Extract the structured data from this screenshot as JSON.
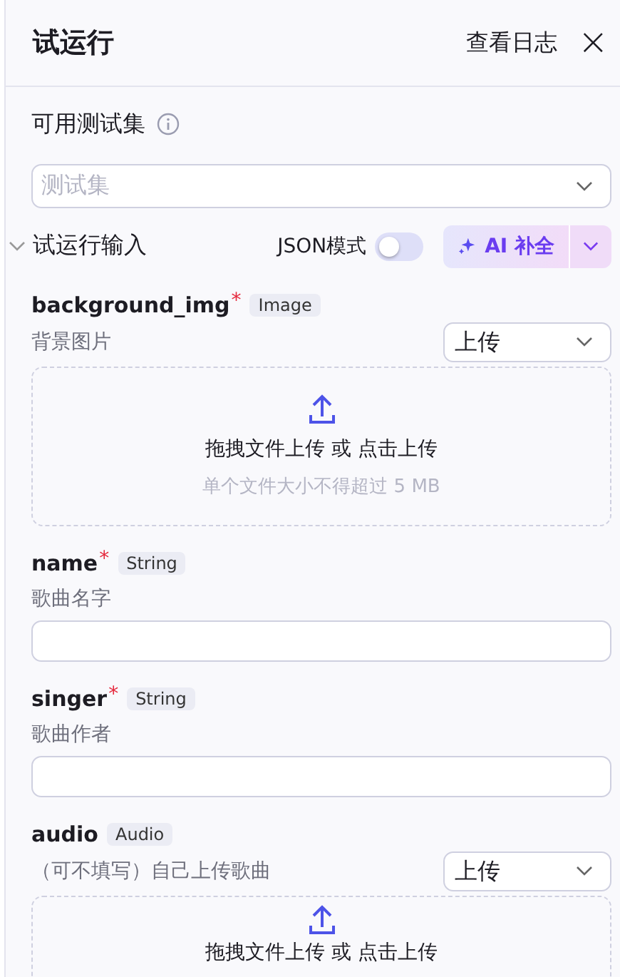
{
  "header": {
    "title": "试运行",
    "log_link": "查看日志",
    "close": "×"
  },
  "test_set": {
    "label": "可用测试集",
    "select": {
      "placeholder": "测试集"
    }
  },
  "inputs_section": {
    "title": "试运行输入",
    "expanded": true,
    "json_mode": {
      "label": "JSON模式",
      "on": false
    },
    "ai_button": "AI 补全"
  },
  "fields": [
    {
      "kind": "upload",
      "name": "background_img",
      "required_mark": "*",
      "type": "Image",
      "description": "背景图片",
      "mode": "上传",
      "drop_text": "拖拽文件上传 或 点击上传",
      "drop_hint": "单个文件大小不得超过 5 MB"
    },
    {
      "kind": "text",
      "name": "name",
      "required_mark": "*",
      "type": "String",
      "description": "歌曲名字"
    },
    {
      "kind": "text",
      "name": "singer",
      "required_mark": "*",
      "type": "String",
      "description": "歌曲作者"
    },
    {
      "kind": "upload",
      "name": "audio",
      "type": "Audio",
      "description": "（可不填写）自己上传歌曲",
      "mode": "上传",
      "drop_text": "拖拽文件上传 或 点击上传"
    }
  ]
}
